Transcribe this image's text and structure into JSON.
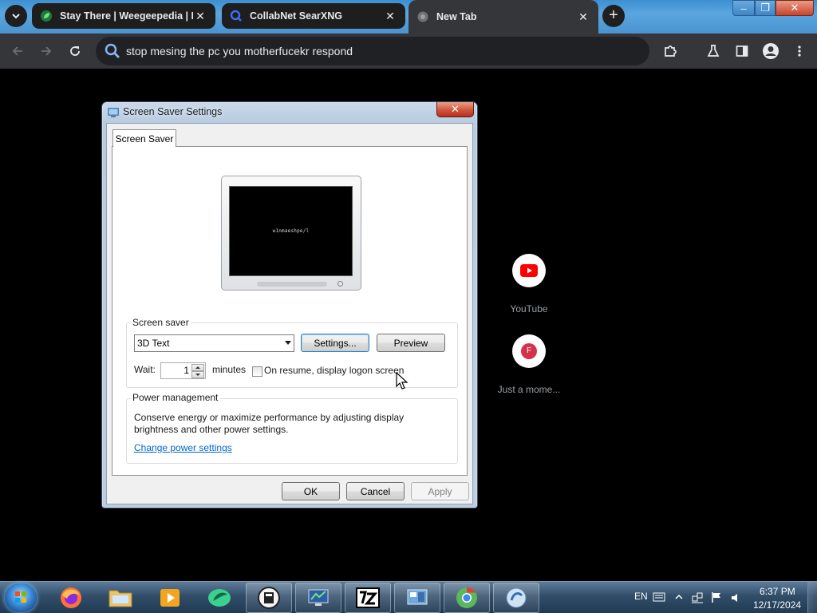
{
  "browser": {
    "tabs": [
      {
        "title": "Stay There | Weegeepedia | Fa",
        "favicon": "weegeepedia-leaf-icon",
        "favicon_color": "#3fbf5f"
      },
      {
        "title": "CollabNet SearXNG",
        "favicon": "search-icon",
        "favicon_color": "#3b6df5"
      },
      {
        "title": "New Tab",
        "favicon": "chrome-globe-icon",
        "favicon_color": "#9aa0a6"
      }
    ],
    "close_glyph": "✕",
    "new_tab_glyph": "+",
    "omnibox_text": "stop mesing the pc you motherfucekr respond",
    "tabstrip_color": "#4a93cf",
    "toolbar_color": "#35363a"
  },
  "window_controls": {
    "minimize": "–",
    "maximize": "❐",
    "close": "✕"
  },
  "dialog": {
    "title": "Screen Saver Settings",
    "close_glyph": "✕",
    "tab_label": "Screen Saver",
    "preview_text": "w1nmaeshpe/l",
    "screen_saver": {
      "group_label": "Screen saver",
      "selected": "3D Text",
      "settings_button": "Settings...",
      "preview_button": "Preview",
      "wait_label": "Wait:",
      "wait_value": "1",
      "minutes_label": "minutes",
      "resume_label": "On resume, display logon screen",
      "resume_checked": false
    },
    "power": {
      "group_label": "Power management",
      "description": "Conserve energy or maximize performance by adjusting display brightness and other power settings.",
      "link": "Change power settings"
    },
    "buttons": {
      "ok": "OK",
      "cancel": "Cancel",
      "apply": "Apply"
    }
  },
  "new_tab_shortcuts": [
    {
      "label": "YouTube",
      "icon": "youtube-icon",
      "color": "#ff0000"
    },
    {
      "label": "Just a mome...",
      "icon_letter": "F",
      "color": "#d6314a"
    }
  ],
  "taskbar": {
    "items": [
      "start-orb",
      "firefox-icon",
      "explorer-folder-icon",
      "media-player-icon",
      "green-app-icon",
      "ballot-app-icon",
      "monitor-app-icon",
      "7zip-icon",
      "control-panel-icon",
      "chrome-icon",
      "windows-tour-icon"
    ],
    "language": "EN",
    "time": "6:37 PM",
    "date": "12/17/2024"
  }
}
